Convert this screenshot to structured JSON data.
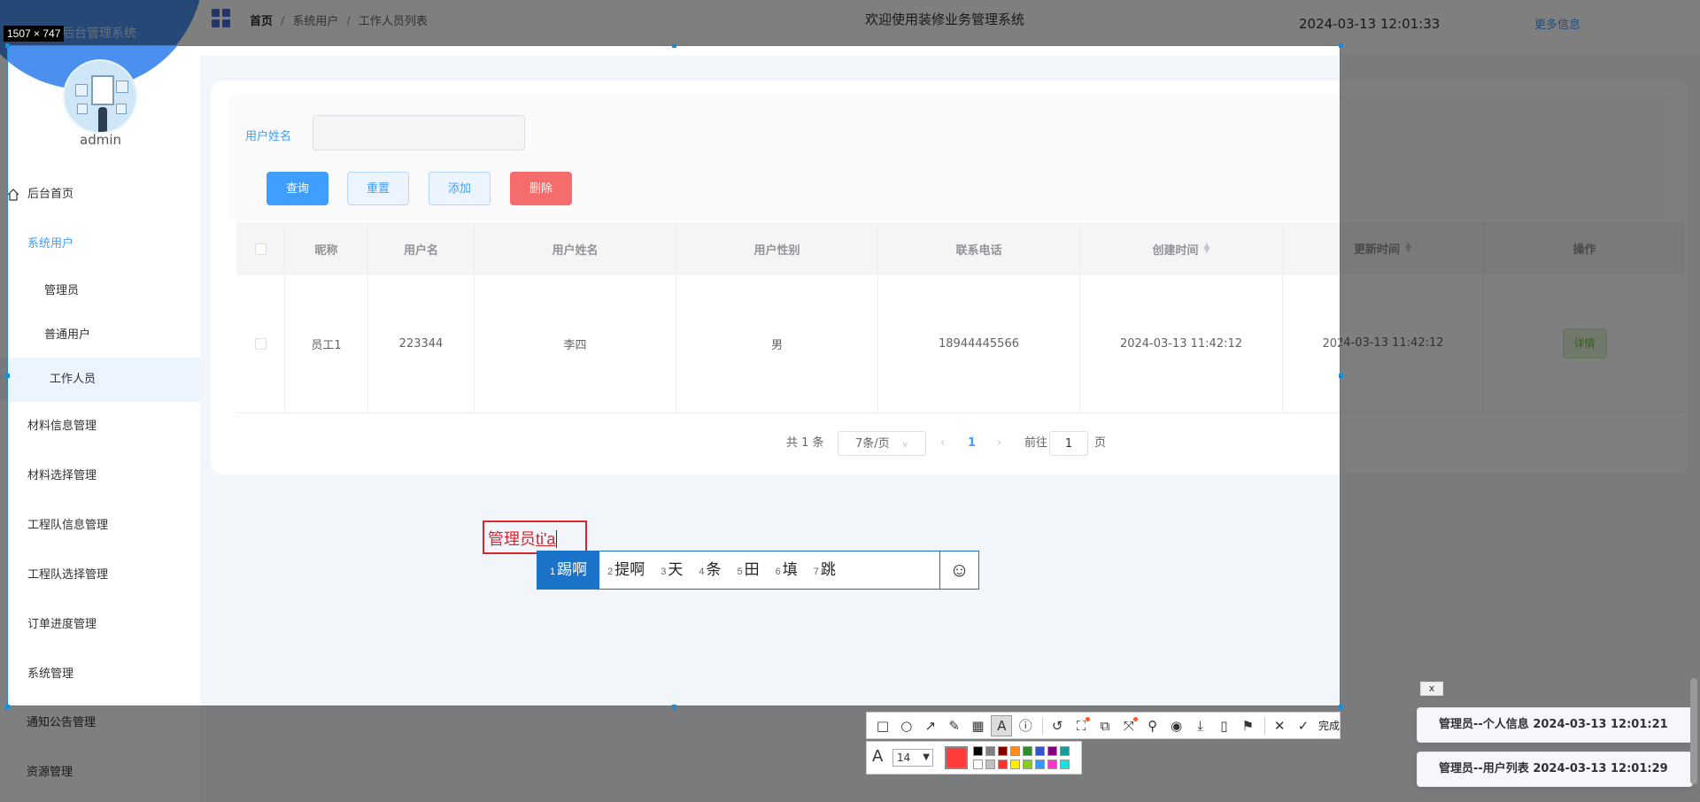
{
  "app": {
    "system_name": "后台管理系统",
    "username": "admin",
    "welcome": "欢迎使用装修业务管理系统",
    "datetime": "2024-03-13 12:01:33",
    "more_info": "更多信息"
  },
  "breadcrumb": [
    "首页",
    "系统用户",
    "工作人员列表"
  ],
  "breadcrumb_sep": "/",
  "menu": {
    "home": "后台首页",
    "system_users": "系统用户",
    "sub_items": [
      "管理员",
      "普通用户",
      "工作人员"
    ],
    "items": [
      "材料信息管理",
      "材料选择管理",
      "工程队信息管理",
      "工程队选择管理",
      "订单进度管理",
      "系统管理",
      "通知公告管理",
      "资源管理"
    ]
  },
  "search": {
    "label": "用户姓名",
    "value": "",
    "buttons": {
      "query": "查询",
      "reset": "重置",
      "add": "添加",
      "delete": "删除"
    }
  },
  "table": {
    "columns": [
      "昵称",
      "用户名",
      "用户姓名",
      "用户性别",
      "联系电话",
      "创建时间",
      "更新时间",
      "操作"
    ],
    "rows": [
      {
        "nickname": "员工1",
        "username": "223344",
        "realname": "李四",
        "gender": "男",
        "phone": "18944445566",
        "created": "2024-03-13 11:42:12",
        "updated": "2024-03-13 11:42:12",
        "action": "详情"
      }
    ]
  },
  "pagination": {
    "total": "共 1 条",
    "page_size": "7条/页",
    "current": "1",
    "goto_prefix": "前往",
    "goto_value": "1",
    "goto_suffix": "页"
  },
  "screenshot_tool": {
    "size_label": "1507 × 747",
    "annotation_text": "管理员",
    "annotation_composing": "ti'a",
    "ime_candidates": [
      {
        "n": "1",
        "text": "踢啊"
      },
      {
        "n": "2",
        "text": "提啊"
      },
      {
        "n": "3",
        "text": "天"
      },
      {
        "n": "4",
        "text": "条"
      },
      {
        "n": "5",
        "text": "田"
      },
      {
        "n": "6",
        "text": "填"
      },
      {
        "n": "7",
        "text": "跳"
      }
    ],
    "done_label": "完成",
    "font_size": "14",
    "current_color": "#ff3b3b",
    "palette_top": [
      "#000000",
      "#808080",
      "#800000",
      "#ff8c1a",
      "#2e8b2e",
      "#3355cc",
      "#800080",
      "#1a9a9a"
    ],
    "palette_bottom": [
      "#ffffff",
      "#c0c0c0",
      "#ff3030",
      "#ffee00",
      "#88cc22",
      "#3399ff",
      "#ff33cc",
      "#22dddd"
    ]
  },
  "notifications": {
    "close": "x",
    "items": [
      "管理员--个人信息 2024-03-13 12:01:21",
      "管理员--用户列表 2024-03-13 12:01:29"
    ]
  }
}
